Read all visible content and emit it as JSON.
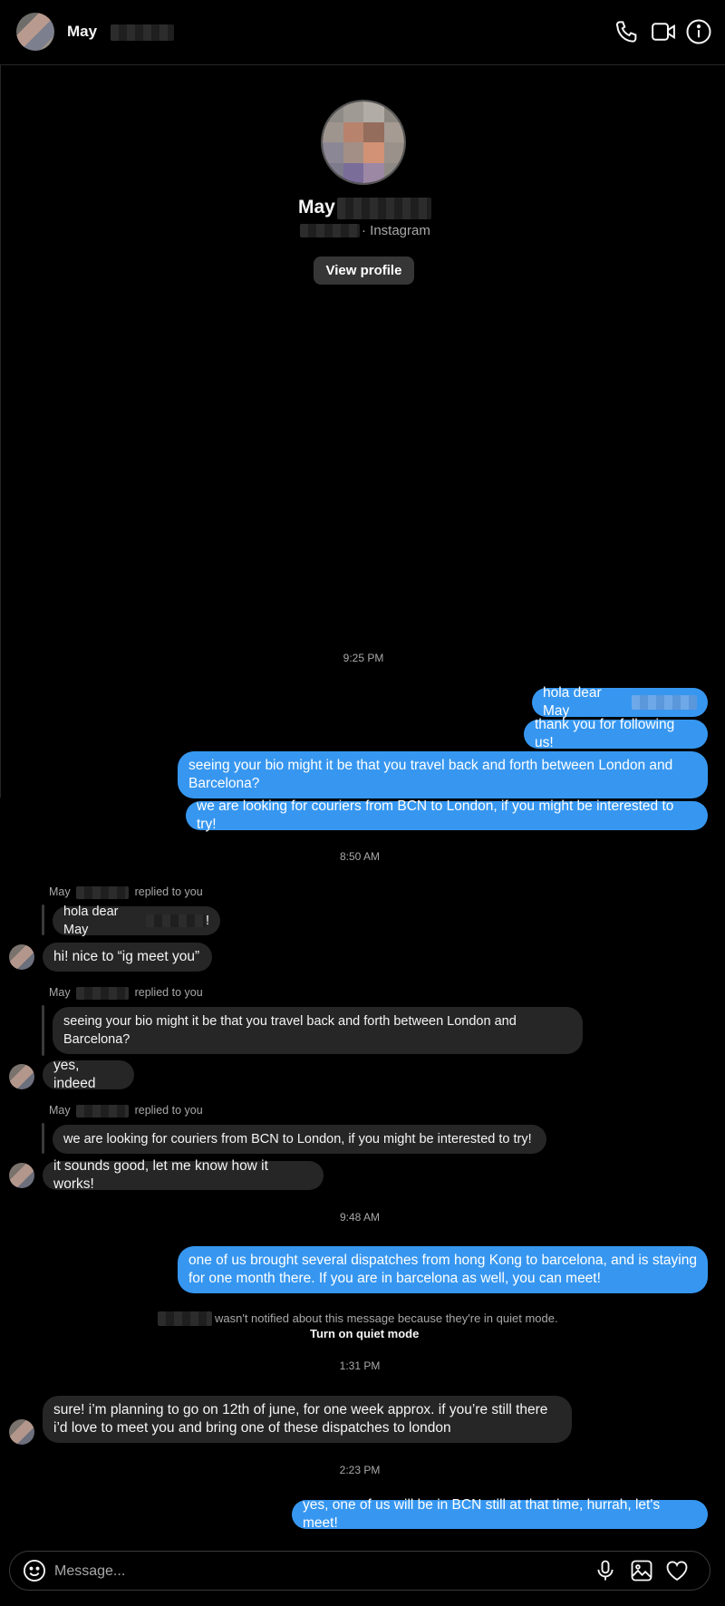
{
  "header": {
    "contact_name": "May",
    "icons": [
      "phone-icon",
      "video-camera-icon",
      "info-icon"
    ]
  },
  "profile": {
    "name": "May",
    "subtitle": "· Instagram",
    "view_profile_label": "View profile"
  },
  "timestamps": [
    "9:25 PM",
    "8:50 AM",
    "9:48 AM",
    "1:31 PM",
    "2:23 PM"
  ],
  "outgoing_1": [
    "hola dear May",
    "thank you for following us!",
    "seeing your bio might it be that you travel back and forth between London and Barcelona?",
    "we are looking for couriers from BCN to London, if you might be interested to try!"
  ],
  "replies": [
    {
      "replied_name": "May",
      "replied_label": "replied to you",
      "quoted": "hola dear May",
      "quoted_suffix": "!",
      "message": "hi! nice to “ig meet you”"
    },
    {
      "replied_name": "May",
      "replied_label": "replied to you",
      "quoted": "seeing your bio might it be that you travel back and forth between London and Barcelona?",
      "message": "yes, indeed"
    },
    {
      "replied_name": "May",
      "replied_label": "replied to you",
      "quoted": "we are looking for couriers from BCN to London, if you might be interested to try!",
      "message": "it sounds good, let me know how it works!"
    }
  ],
  "outgoing_2": "one of us brought several dispatches from hong Kong to barcelona, and is staying for one month there. If you are in barcelona as well, you can meet!",
  "quiet_mode": {
    "note": "wasn't notified about this message because they're in quiet mode.",
    "link": "Turn on quiet mode"
  },
  "incoming_final": "sure! i’m planning to go on 12th of june, for one week approx. if you’re still there i’d love to meet you and bring one of these dispatches to london",
  "outgoing_final": "yes, one of us will be in BCN still at that time, hurrah, let's meet!",
  "composer": {
    "placeholder": "Message...",
    "icons": [
      "emoji-icon",
      "microphone-icon",
      "image-icon",
      "heart-icon"
    ]
  },
  "colors": {
    "outgoing_bubble": "#3797f0",
    "incoming_bubble": "#262626",
    "background": "#000000"
  }
}
